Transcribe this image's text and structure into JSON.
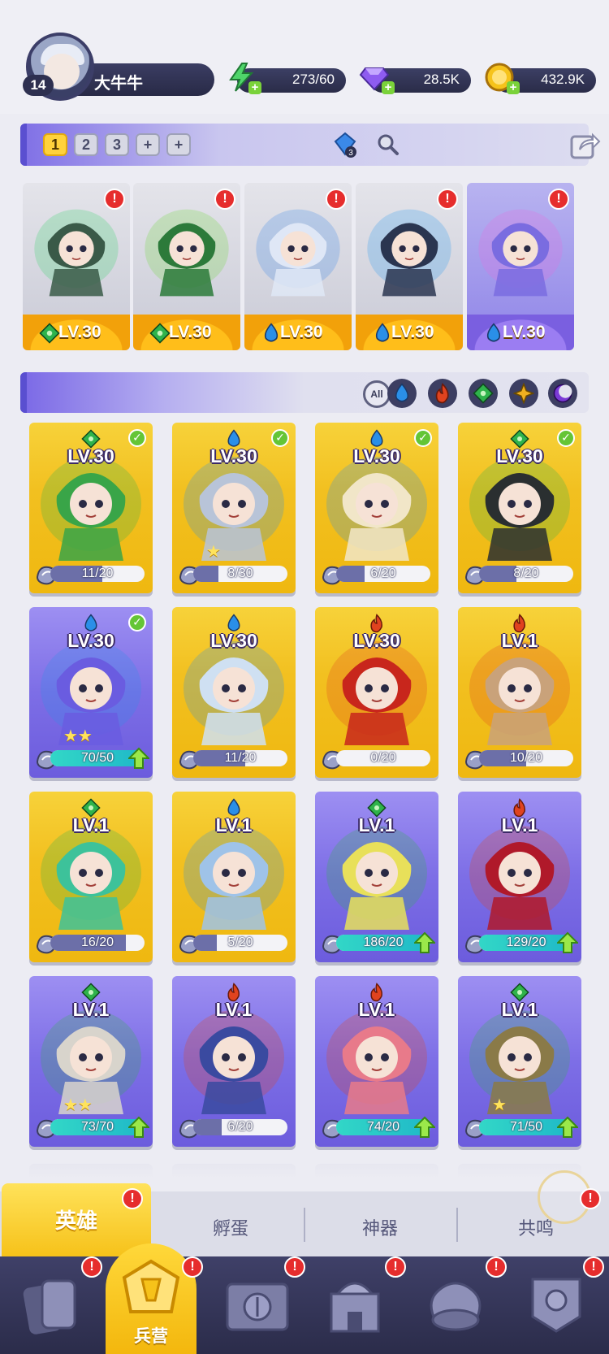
{
  "player": {
    "level": "14",
    "name": "大牛牛"
  },
  "resources": [
    {
      "name": "stamina",
      "icon": "lightning-icon",
      "value": "273/60",
      "color": "#4fd46a"
    },
    {
      "name": "gems",
      "icon": "diamond-icon",
      "value": "28.5K",
      "color": "#8e5cf0"
    },
    {
      "name": "coins",
      "icon": "coin-icon",
      "value": "432.9K",
      "color": "#f6c31b"
    }
  ],
  "team_tabs": [
    "1",
    "2",
    "3",
    "+",
    "+"
  ],
  "team_gem_count": "3",
  "team": [
    {
      "element": "earth",
      "level": "LV.30",
      "card": "gray",
      "body": "#3a5a48",
      "accent": "#37d36b"
    },
    {
      "element": "earth",
      "level": "LV.30",
      "card": "gray",
      "body": "#2c7a3a",
      "accent": "#6ed93a"
    },
    {
      "element": "water",
      "level": "LV.30",
      "card": "gray",
      "body": "#dfe7f6",
      "accent": "#3b89e8"
    },
    {
      "element": "water",
      "level": "LV.30",
      "card": "gray",
      "body": "#2a3550",
      "accent": "#2a9df0"
    },
    {
      "element": "water",
      "level": "LV.30",
      "card": "purple",
      "body": "#7a6ce0",
      "accent": "#e86ae0"
    }
  ],
  "filters": {
    "all_label": "All",
    "elements": [
      "water",
      "fire",
      "earth",
      "light",
      "dark"
    ]
  },
  "element_colors": {
    "water": "#2a8fe8",
    "fire": "#e0431f",
    "earth": "#2fb34b",
    "light": "#f0b020",
    "dark": "#7b3ad6"
  },
  "heroes": [
    {
      "level": "LV.30",
      "element": "earth",
      "card": "gold",
      "progress": "11/20",
      "fraction": 0.55,
      "checked": true,
      "upgrade": false,
      "stars": 0,
      "body": "#39a548"
    },
    {
      "level": "LV.30",
      "element": "water",
      "card": "gold",
      "progress": "8/30",
      "fraction": 0.27,
      "checked": true,
      "upgrade": false,
      "stars": 1,
      "body": "#b8c4d8"
    },
    {
      "level": "LV.30",
      "element": "water",
      "card": "gold",
      "progress": "6/20",
      "fraction": 0.3,
      "checked": true,
      "upgrade": false,
      "stars": 0,
      "body": "#f1e6c8"
    },
    {
      "level": "LV.30",
      "element": "earth",
      "card": "gold",
      "progress": "8/20",
      "fraction": 0.4,
      "checked": true,
      "upgrade": false,
      "stars": 0,
      "body": "#2a2f30"
    },
    {
      "level": "LV.30",
      "element": "water",
      "card": "purple",
      "progress": "70/50",
      "fraction": 1,
      "checked": true,
      "upgrade": true,
      "stars": 2,
      "body": "#6a5ce0"
    },
    {
      "level": "LV.30",
      "element": "water",
      "card": "gold",
      "progress": "11/20",
      "fraction": 0.55,
      "checked": false,
      "upgrade": false,
      "stars": 0,
      "body": "#cfe0f2"
    },
    {
      "level": "LV.30",
      "element": "fire",
      "card": "gold",
      "progress": "0/20",
      "fraction": 0,
      "checked": false,
      "upgrade": false,
      "stars": 0,
      "body": "#c8261c"
    },
    {
      "level": "LV.1",
      "element": "fire",
      "card": "gold",
      "progress": "10/20",
      "fraction": 0.5,
      "checked": false,
      "upgrade": false,
      "stars": 0,
      "body": "#c9a27a"
    },
    {
      "level": "LV.1",
      "element": "earth",
      "card": "gold",
      "progress": "16/20",
      "fraction": 0.8,
      "checked": false,
      "upgrade": false,
      "stars": 0,
      "body": "#3dc29a"
    },
    {
      "level": "LV.1",
      "element": "water",
      "card": "gold",
      "progress": "5/20",
      "fraction": 0.25,
      "checked": false,
      "upgrade": false,
      "stars": 0,
      "body": "#9fc3e8"
    },
    {
      "level": "LV.1",
      "element": "earth",
      "card": "purple",
      "progress": "186/20",
      "fraction": 1,
      "checked": false,
      "upgrade": true,
      "stars": 0,
      "body": "#e8e05a"
    },
    {
      "level": "LV.1",
      "element": "fire",
      "card": "purple",
      "progress": "129/20",
      "fraction": 1,
      "checked": false,
      "upgrade": true,
      "stars": 0,
      "body": "#b0192a"
    },
    {
      "level": "LV.1",
      "element": "earth",
      "card": "purple",
      "progress": "73/70",
      "fraction": 1,
      "checked": false,
      "upgrade": true,
      "stars": 2,
      "body": "#d8d4cc"
    },
    {
      "level": "LV.1",
      "element": "fire",
      "card": "purple",
      "progress": "6/20",
      "fraction": 0.3,
      "checked": false,
      "upgrade": false,
      "stars": 0,
      "body": "#3a4aa0"
    },
    {
      "level": "LV.1",
      "element": "fire",
      "card": "purple",
      "progress": "74/20",
      "fraction": 1,
      "checked": false,
      "upgrade": true,
      "stars": 0,
      "body": "#e87a8a"
    },
    {
      "level": "LV.1",
      "element": "earth",
      "card": "purple",
      "progress": "71/50",
      "fraction": 1,
      "checked": false,
      "upgrade": true,
      "stars": 1,
      "body": "#8a7a48"
    }
  ],
  "sub_tabs": {
    "active": "英雄",
    "others": [
      "孵蛋",
      "神器",
      "共鸣"
    ]
  },
  "bottom_nav": [
    {
      "icon": "cards-icon",
      "label": ""
    },
    {
      "icon": "barracks-icon",
      "label": "兵营",
      "active": true
    },
    {
      "icon": "map-icon",
      "label": ""
    },
    {
      "icon": "castle-icon",
      "label": ""
    },
    {
      "icon": "guild-icon",
      "label": ""
    },
    {
      "icon": "banner-icon",
      "label": ""
    }
  ],
  "alert_mark": "!"
}
